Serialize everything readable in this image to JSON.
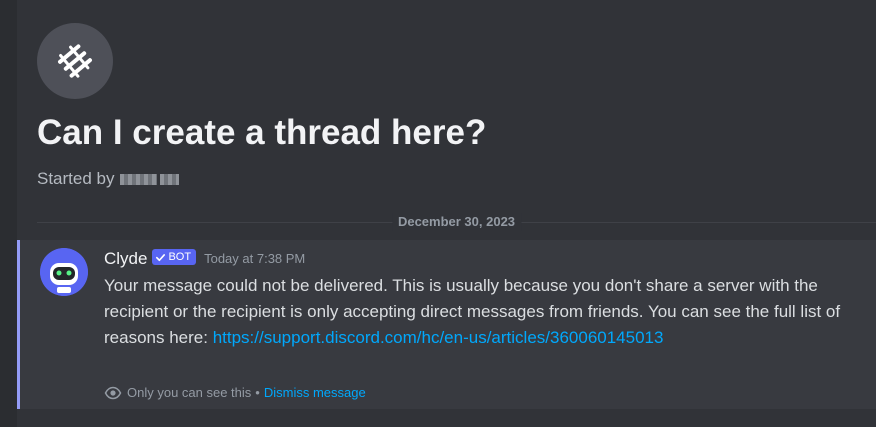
{
  "thread": {
    "title": "Can I create a thread here?",
    "started_by_label": "Started by",
    "icon": "thread-icon"
  },
  "divider": {
    "date": "December 30, 2023"
  },
  "message": {
    "author": "Clyde",
    "bot_tag": "BOT",
    "timestamp": "Today at 7:38 PM",
    "text": "Your message could not be delivered. This is usually because you don't share a server with the recipient or the recipient is only accepting direct messages from friends. You can see the full list of reasons here: ",
    "link": "https://support.discord.com/hc/en-us/articles/360060145013",
    "ephemeral_note": "Only you can see this",
    "separator": "•",
    "dismiss_label": "Dismiss message",
    "avatar_icon": "clyde-robot-icon",
    "accent": "#949cf7"
  },
  "colors": {
    "background": "#313338",
    "brand": "#5865f2",
    "link": "#00a8fc"
  }
}
